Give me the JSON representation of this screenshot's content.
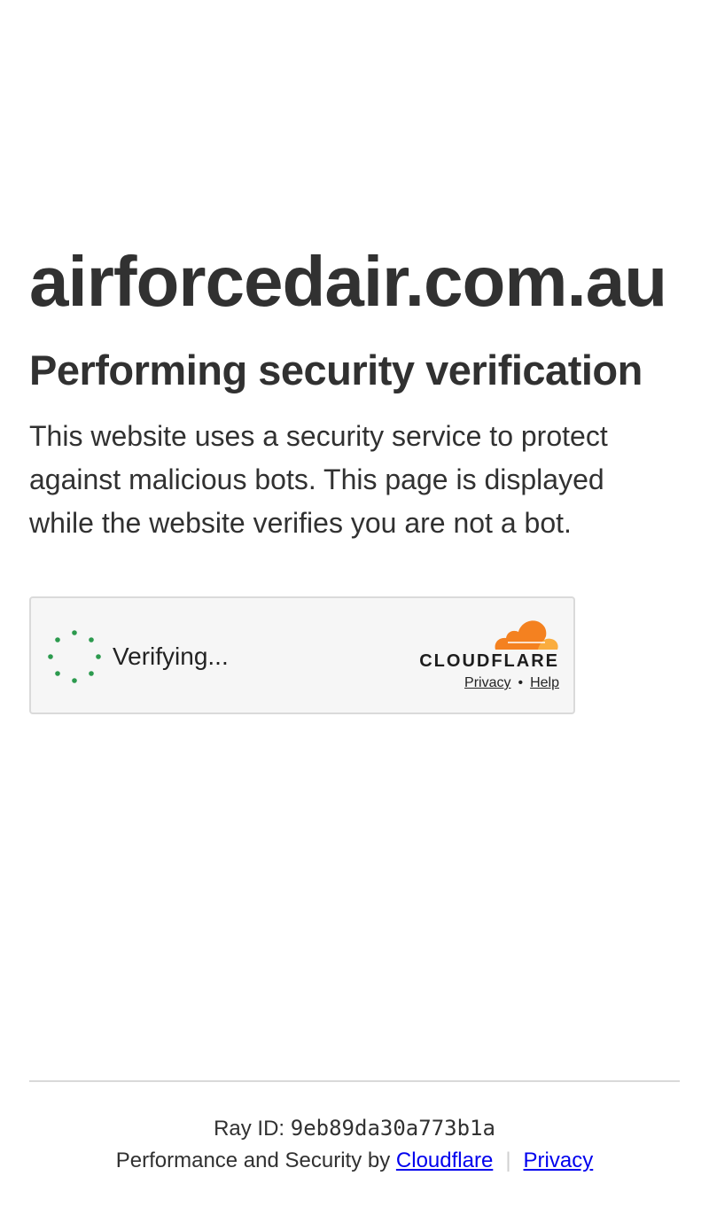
{
  "header": {
    "site_title": "airforcedair.com.au",
    "subtitle": "Performing security verification",
    "description": "This website uses a security service to protect against malicious bots. This page is displayed while the website verifies you are not a bot."
  },
  "challenge_widget": {
    "status_text": "Verifying...",
    "spinner_icon": "spinner-icon",
    "brand_wordmark": "CLOUDFLARE",
    "privacy_label": "Privacy",
    "link_separator": "•",
    "help_label": "Help",
    "spinner_color": "#2c9a4e",
    "cloud_colors": [
      "#f48120",
      "#faad3f"
    ]
  },
  "footer": {
    "ray_label": "Ray ID:",
    "ray_id": "9eb89da30a773b1a",
    "performance_text": "Performance and Security by",
    "cloudflare_link": "Cloudflare",
    "separator": "|",
    "privacy_link": "Privacy",
    "link_color": "#0000ee"
  }
}
